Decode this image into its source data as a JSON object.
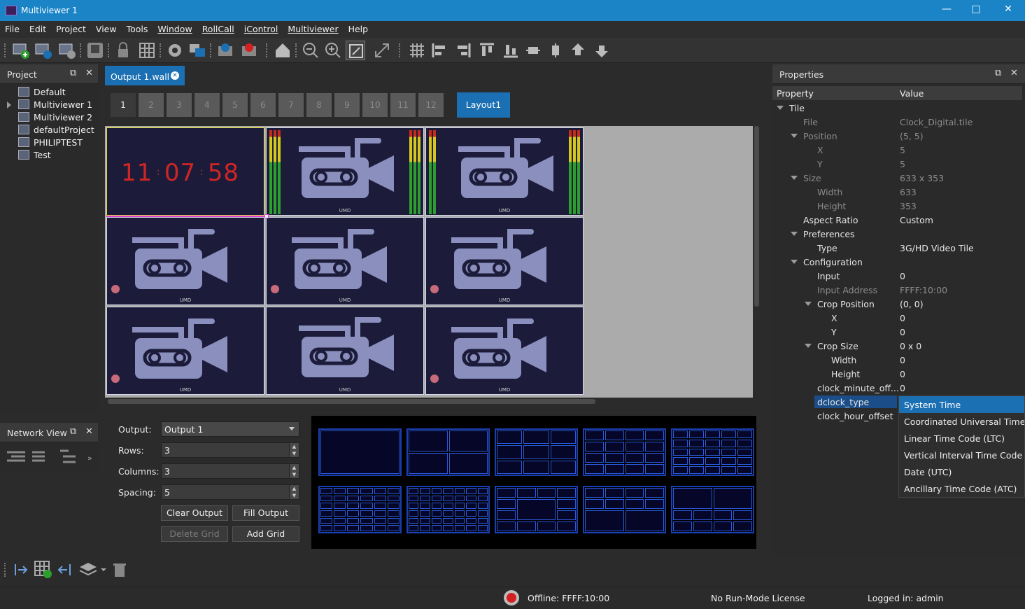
{
  "window": {
    "title": "Multiviewer 1"
  },
  "menu": [
    "File",
    "Edit",
    "Project",
    "View",
    "Tools",
    "Window",
    "RollCall",
    "iControl",
    "Multiviewer",
    "Help"
  ],
  "project_panel": {
    "title": "Project",
    "items": [
      "Default",
      "Multiviewer 1",
      "Multiviewer 2",
      "defaultProject",
      "PHILIPTEST",
      "Test"
    ]
  },
  "network_panel": {
    "title": "Network View"
  },
  "document_tab": {
    "label": "Output 1.wall"
  },
  "pages": [
    "1",
    "2",
    "3",
    "4",
    "5",
    "6",
    "7",
    "8",
    "9",
    "10",
    "11",
    "12"
  ],
  "layout_button": "Layout1",
  "clock": {
    "hours": "11",
    "minutes": "07",
    "seconds": "58"
  },
  "umd_label": "UMD",
  "output_settings": {
    "output_label": "Output:",
    "output_value": "Output 1",
    "rows_label": "Rows:",
    "rows_value": "3",
    "columns_label": "Columns:",
    "columns_value": "3",
    "spacing_label": "Spacing:",
    "spacing_value": "5",
    "clear_output": "Clear Output",
    "fill_output": "Fill Output",
    "delete_grid": "Delete Grid",
    "add_grid": "Add Grid"
  },
  "properties": {
    "title": "Properties",
    "col_property": "Property",
    "col_value": "Value",
    "rows": [
      {
        "name": "Tile",
        "value": ""
      },
      {
        "name": "File",
        "value": "Clock_Digital.tile"
      },
      {
        "name": "Position",
        "value": "(5, 5)"
      },
      {
        "name": "X",
        "value": "5"
      },
      {
        "name": "Y",
        "value": "5"
      },
      {
        "name": "Size",
        "value": "633 x 353"
      },
      {
        "name": "Width",
        "value": "633"
      },
      {
        "name": "Height",
        "value": "353"
      },
      {
        "name": "Aspect Ratio",
        "value": "Custom"
      },
      {
        "name": "Preferences",
        "value": ""
      },
      {
        "name": "Type",
        "value": "3G/HD Video Tile"
      },
      {
        "name": "Configuration",
        "value": ""
      },
      {
        "name": "Input",
        "value": "0"
      },
      {
        "name": "Input Address",
        "value": "FFFF:10:00"
      },
      {
        "name": "Crop Position",
        "value": "(0, 0)"
      },
      {
        "name": "X",
        "value": "0"
      },
      {
        "name": "Y",
        "value": "0"
      },
      {
        "name": "Crop Size",
        "value": "0 x 0"
      },
      {
        "name": "Width",
        "value": "0"
      },
      {
        "name": "Height",
        "value": "0"
      },
      {
        "name": "clock_minute_off...",
        "value": "0"
      },
      {
        "name": "dclock_type",
        "value": ""
      },
      {
        "name": "clock_hour_offset",
        "value": ""
      }
    ]
  },
  "clock_type_options": [
    "System Time",
    "Coordinated Universal Time (U",
    "Linear Time Code (LTC)",
    "Vertical Interval Time Code (V",
    "Date (UTC)",
    "Ancillary Time Code (ATC)"
  ],
  "status": {
    "offline": "Offline: FFFF:10:00",
    "license": "No Run-Mode License",
    "logged_in": "Logged in: admin"
  },
  "colors": {
    "accent": "#1b6fb3",
    "titlebar": "#1a84c7",
    "clock": "#d02525"
  }
}
